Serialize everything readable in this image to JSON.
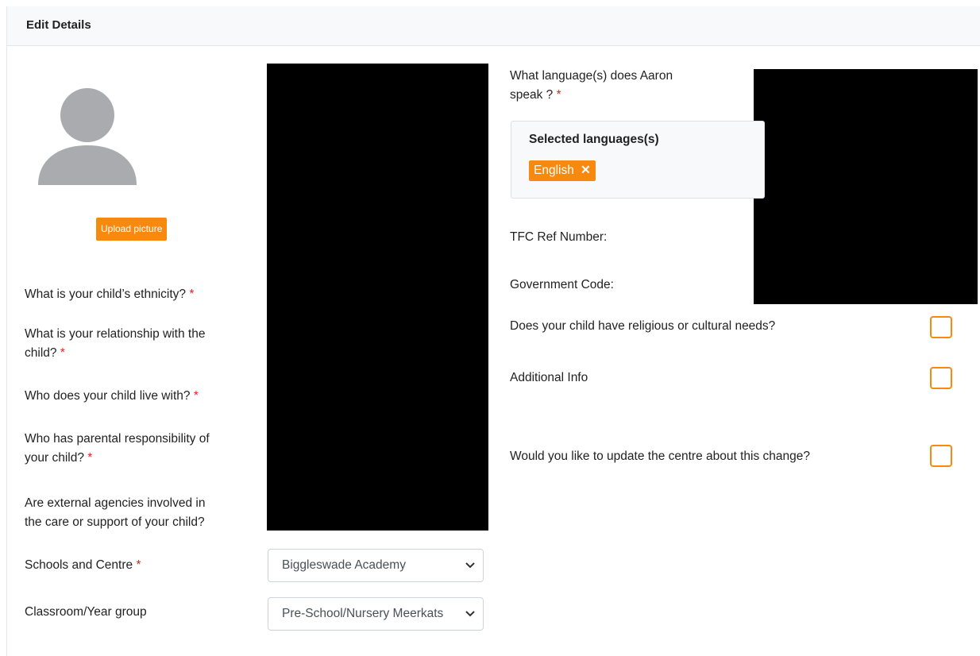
{
  "header": {
    "title": "Edit Details"
  },
  "profile": {
    "avatar_icon": "user-avatar-icon",
    "upload_label": "Upload picture"
  },
  "left_fields": {
    "ethnicity": "What is your child’s ethnicity?",
    "relationship_line1": "What is your relationship with the",
    "relationship_line2": "child?",
    "lives_with": "Who does your child live with?",
    "parental_line1": "Who has parental responsibility of",
    "parental_line2": "your child?",
    "agencies_line1": "Are external agencies involved in",
    "agencies_line2": "the care or support of your child?",
    "schools": "Schools and Centre",
    "classroom": "Classroom/Year group",
    "required_marker": "*"
  },
  "selects": {
    "school_value": "Biggleswade Academy",
    "classroom_value": "Pre-School/Nursery Meerkats"
  },
  "right_fields": {
    "language_line1": "What language(s) does Aaron",
    "language_line2": "speak ?",
    "selected_languages_title": "Selected languages(s)",
    "selected_language": "English",
    "remove_symbol": "✕",
    "tfc_ref": "TFC Ref Number:",
    "gov_code": "Government Code:",
    "religious_needs": "Does your child have religious or cultural needs?",
    "additional_info": "Additional Info",
    "update_centre": "Would you like to update the centre about this change?"
  },
  "colors": {
    "accent": "#f7890f",
    "required": "#e02424",
    "header_bg": "#f8f9fb"
  }
}
